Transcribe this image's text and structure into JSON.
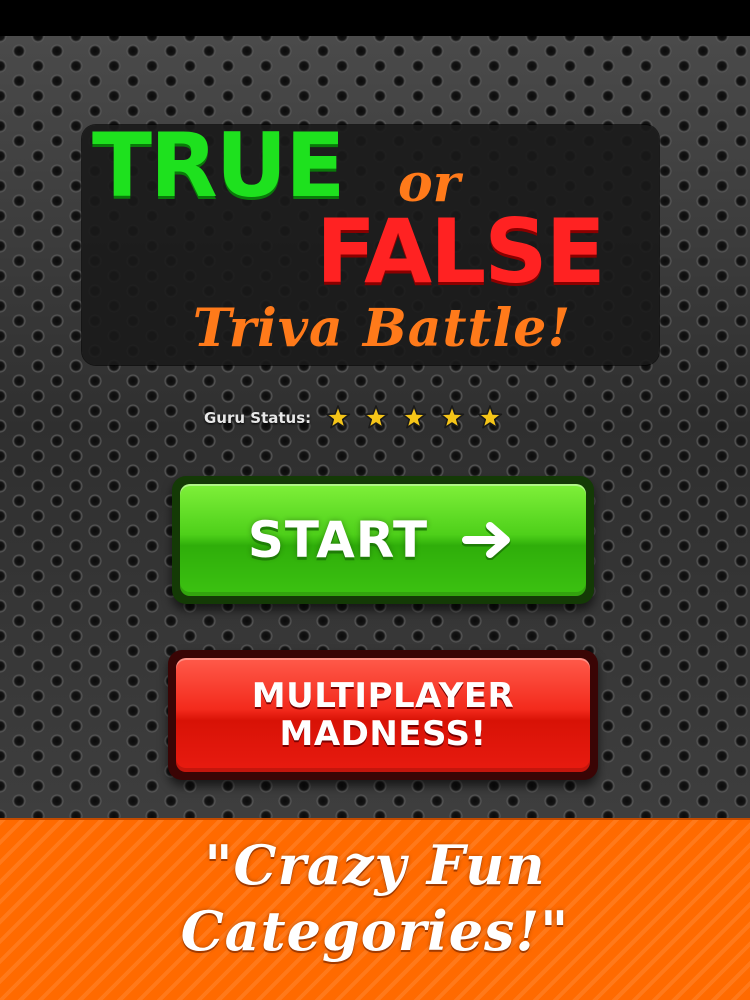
{
  "title": {
    "true_word": "TRUE",
    "or_word": "or",
    "false_word": "FALSE",
    "subtitle": "Triva Battle!"
  },
  "guru": {
    "label": "Guru Status:",
    "stars": 5,
    "stars_max": 5
  },
  "buttons": {
    "start_label": "START",
    "multiplayer_line1": "MULTIPLAYER",
    "multiplayer_line2": "MADNESS!"
  },
  "banner": {
    "line1": "\"Crazy Fun",
    "line2": "Categories!\""
  },
  "icons": {
    "star": "star-icon",
    "arrow": "arrow-right-icon"
  },
  "colors": {
    "true_green": "#1ee11e",
    "false_red": "#ff2222",
    "accent_orange": "#ff7a1a",
    "start_green": "#4ed01a",
    "multi_red": "#f32a1c",
    "banner_orange": "#ff6a00",
    "star_gold": "#f5c518"
  }
}
